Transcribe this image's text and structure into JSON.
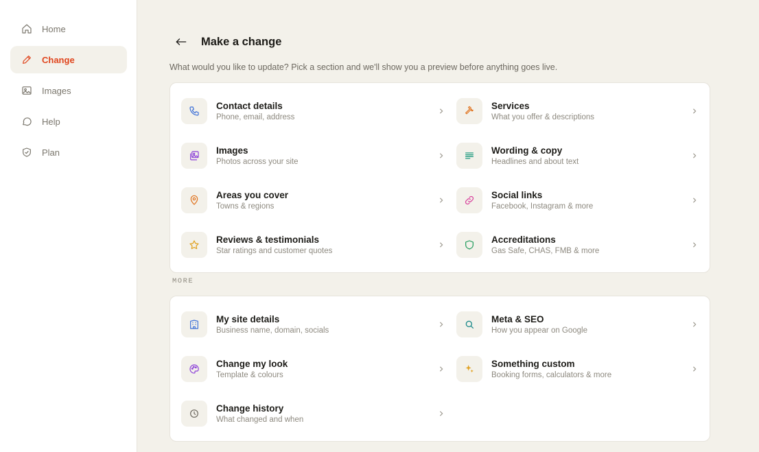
{
  "sidebar": {
    "items": [
      {
        "label": "Home",
        "icon": "home-icon",
        "active": false
      },
      {
        "label": "Change",
        "icon": "pencil-icon",
        "active": true
      },
      {
        "label": "Images",
        "icon": "image-icon",
        "active": false
      },
      {
        "label": "Help",
        "icon": "chat-bubble-icon",
        "active": false
      },
      {
        "label": "Plan",
        "icon": "shield-check-icon",
        "active": false
      }
    ]
  },
  "header": {
    "title": "Make a change",
    "subtitle": "What would you like to update? Pick a section and we'll show you a preview before anything goes live."
  },
  "primary": [
    {
      "title": "Contact details",
      "desc": "Phone, email, address",
      "icon": "phone-icon",
      "color": "#3b6fd8"
    },
    {
      "title": "Services",
      "desc": "What you offer & descriptions",
      "icon": "wrench-icon",
      "color": "#e0721d"
    },
    {
      "title": "Images",
      "desc": "Photos across your site",
      "icon": "images-icon",
      "color": "#8b3fd8"
    },
    {
      "title": "Wording & copy",
      "desc": "Headlines and about text",
      "icon": "text-lines-icon",
      "color": "#1d9a7e"
    },
    {
      "title": "Areas you cover",
      "desc": "Towns & regions",
      "icon": "map-pin-icon",
      "color": "#e0721d"
    },
    {
      "title": "Social links",
      "desc": "Facebook, Instagram & more",
      "icon": "link-icon",
      "color": "#d83f9b"
    },
    {
      "title": "Reviews & testimonials",
      "desc": "Star ratings and customer quotes",
      "icon": "star-icon",
      "color": "#e0a01d"
    },
    {
      "title": "Accreditations",
      "desc": "Gas Safe, CHAS, FMB & more",
      "icon": "shield-icon",
      "color": "#1d9a5a"
    }
  ],
  "more_label": "MORE",
  "more": [
    {
      "title": "My site details",
      "desc": "Business name, domain, socials",
      "icon": "building-icon",
      "color": "#3b6fd8"
    },
    {
      "title": "Meta & SEO",
      "desc": "How you appear on Google",
      "icon": "search-icon",
      "color": "#1d8a8a"
    },
    {
      "title": "Change my look",
      "desc": "Template & colours",
      "icon": "palette-icon",
      "color": "#8b3fd8"
    },
    {
      "title": "Something custom",
      "desc": "Booking forms, calculators & more",
      "icon": "sparkle-icon",
      "color": "#e0a01d"
    },
    {
      "title": "Change history",
      "desc": "What changed and when",
      "icon": "clock-icon",
      "color": "#6c685f"
    }
  ]
}
